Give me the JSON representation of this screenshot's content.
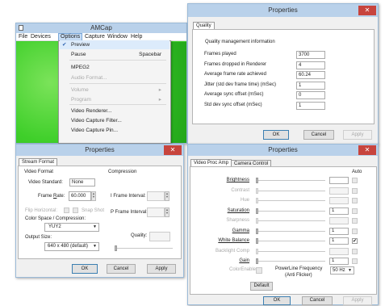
{
  "amcap": {
    "title": "AMCap",
    "menu": [
      "File",
      "Devices",
      "Options",
      "Capture",
      "Window",
      "Help"
    ],
    "options_menu": [
      {
        "label": "Preview",
        "checked": true,
        "shortcut": "",
        "disabled": false,
        "arrow": false
      },
      {
        "label": "Pause",
        "checked": false,
        "shortcut": "Spacebar",
        "disabled": false,
        "arrow": false
      },
      {
        "label": "MPEG2",
        "checked": false,
        "shortcut": "",
        "disabled": false,
        "arrow": false
      },
      {
        "label": "Audio Format...",
        "checked": false,
        "shortcut": "",
        "disabled": true,
        "arrow": false
      },
      {
        "label": "Volume",
        "checked": false,
        "shortcut": "",
        "disabled": true,
        "arrow": true
      },
      {
        "label": "Program",
        "checked": false,
        "shortcut": "",
        "disabled": true,
        "arrow": true
      },
      {
        "label": "Video Renderer...",
        "checked": false,
        "shortcut": "",
        "disabled": false,
        "arrow": false
      },
      {
        "label": "Video Capture Filter...",
        "checked": false,
        "shortcut": "",
        "disabled": false,
        "arrow": false
      },
      {
        "label": "Video Capture Pin...",
        "checked": false,
        "shortcut": "",
        "disabled": false,
        "arrow": false
      }
    ]
  },
  "quality": {
    "title": "Properties",
    "tab": "Quality",
    "group": "Quality management information",
    "rows": [
      {
        "label": "Frames played",
        "value": "3700"
      },
      {
        "label": "Frames dropped in Renderer",
        "value": "4"
      },
      {
        "label": "Average frame rate achieved",
        "value": "60.24"
      },
      {
        "label": "Jitter (std dev frame time) (mSec)",
        "value": "1"
      },
      {
        "label": "Average sync offset (mSec)",
        "value": "0"
      },
      {
        "label": "Std dev sync offset (mSec)",
        "value": "1"
      }
    ],
    "ok": "OK",
    "cancel": "Cancel",
    "apply": "Apply"
  },
  "stream": {
    "title": "Properties",
    "tab": "Stream Format",
    "video_format_group": "Video Format",
    "compression_group": "Compression",
    "video_standard_label": "Video Standard:",
    "video_standard_value": "None",
    "frame_rate_label": "Frame Rate:",
    "frame_rate_value": "60.000",
    "flip_label": "Flip Horizontal:",
    "snap_label": "Snap Shot",
    "color_space_label": "Color Space / Compression:",
    "color_space_value": "YUY2",
    "output_size_label": "Output Size:",
    "output_size_value": "640 x 480  (default)",
    "iframe_label": "I Frame Interval:",
    "pframe_label": "P Frame Interval:",
    "quality_label": "Quality:",
    "ok": "OK",
    "cancel": "Cancel",
    "apply": "Apply"
  },
  "procamp": {
    "title": "Properties",
    "tabs": [
      "Video Proc Amp",
      "Camera Control"
    ],
    "auto_label": "Auto",
    "rows": [
      {
        "label": "Brightness",
        "enabled": true,
        "value": "",
        "auto": false,
        "auto_enabled": false
      },
      {
        "label": "Contrast",
        "enabled": false,
        "value": "",
        "auto": false,
        "auto_enabled": false
      },
      {
        "label": "Hue",
        "enabled": false,
        "value": "",
        "auto": false,
        "auto_enabled": false
      },
      {
        "label": "Saturation",
        "enabled": true,
        "value": "1",
        "auto": false,
        "auto_enabled": false
      },
      {
        "label": "Sharpness",
        "enabled": false,
        "value": "",
        "auto": false,
        "auto_enabled": false
      },
      {
        "label": "Gamma",
        "enabled": true,
        "value": "1",
        "auto": false,
        "auto_enabled": false
      },
      {
        "label": "White Balance",
        "enabled": true,
        "value": "1",
        "auto": true,
        "auto_enabled": true
      },
      {
        "label": "Backlight Comp",
        "enabled": false,
        "value": "",
        "auto": false,
        "auto_enabled": false
      },
      {
        "label": "Gain",
        "enabled": true,
        "value": "1",
        "auto": false,
        "auto_enabled": false
      }
    ],
    "color_enable_label": "ColorEnable",
    "powerline_label_1": "PowerLine Frequency",
    "powerline_label_2": "(Anti Flicker)",
    "powerline_value": "50 Hz",
    "default_label": "Default",
    "ok": "OK",
    "cancel": "Cancel",
    "apply": "Apply"
  },
  "colors": {
    "title_bar": "#b9d1ea",
    "close": "#c7443d",
    "preview_green": "#3fcf2a",
    "menu_highlight": "#c7ddf5"
  }
}
